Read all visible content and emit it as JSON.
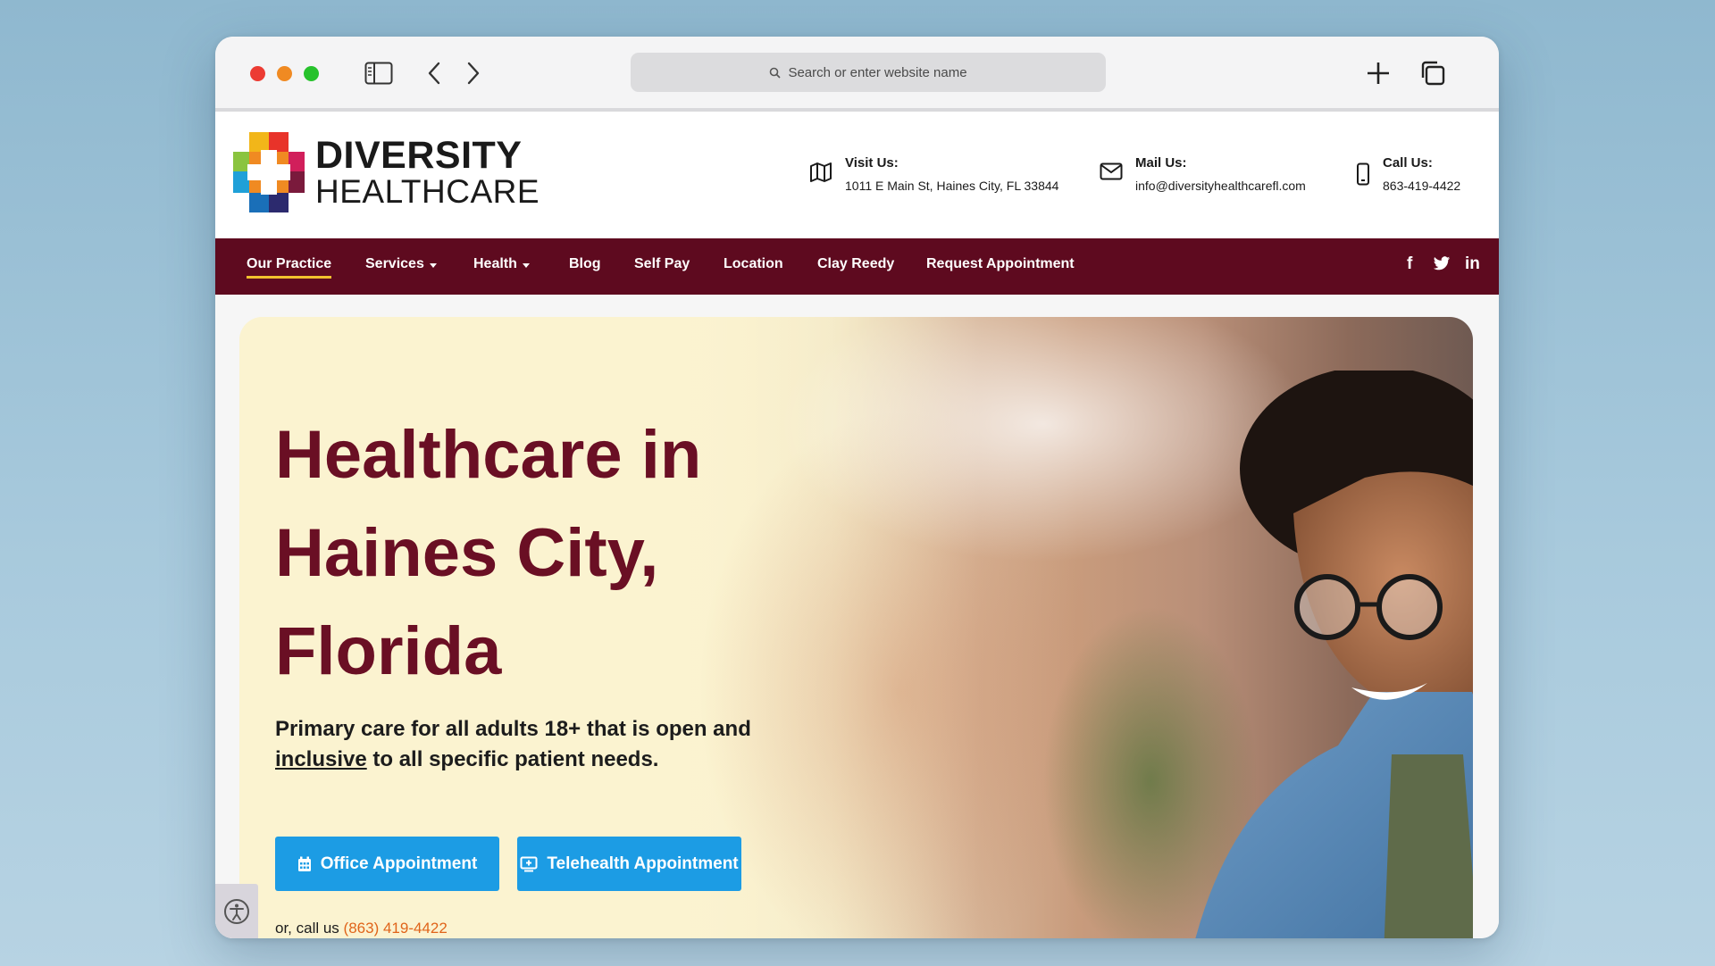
{
  "browser": {
    "url_placeholder": "Search or enter website name"
  },
  "site": {
    "logo": {
      "line1": "DIVERSITY",
      "line2": "HEALTHCARE"
    },
    "contacts": [
      {
        "label": "Visit Us:",
        "value": "1011 E Main St, Haines City, FL 33844",
        "icon": "map-icon"
      },
      {
        "label": "Mail Us:",
        "value": "info@diversityhealthcarefl.com",
        "icon": "mail-icon"
      },
      {
        "label": "Call Us:",
        "value": "863-419-4422",
        "icon": "phone-icon"
      }
    ],
    "nav": [
      {
        "label": "Our Practice",
        "active": true
      },
      {
        "label": "Services",
        "dropdown": true
      },
      {
        "label": "Health",
        "dropdown": true
      },
      {
        "label": "Blog"
      },
      {
        "label": "Self Pay"
      },
      {
        "label": "Location"
      },
      {
        "label": "Clay Reedy"
      },
      {
        "label": "Request Appointment"
      }
    ],
    "social": {
      "facebook": "f",
      "twitter": "twitter-icon",
      "linkedin": "in"
    }
  },
  "hero": {
    "title": "Healthcare in Haines City, Florida",
    "subtitle_part1": "Primary care for all adults 18+ that is open and",
    "subtitle_underlined": "inclusive",
    "subtitle_part2": "to all specific patient needs.",
    "buttons": {
      "office": "Office Appointment",
      "telehealth": "Telehealth Appointment"
    },
    "call_prefix": "or, call us",
    "call_phone": "(863) 419-4422"
  },
  "colors": {
    "brand_maroon": "#5e0a1f",
    "title_maroon": "#6a0f24",
    "button_blue": "#1c9ce4",
    "active_underline": "#f2c12e",
    "phone_orange": "#e0641a"
  }
}
